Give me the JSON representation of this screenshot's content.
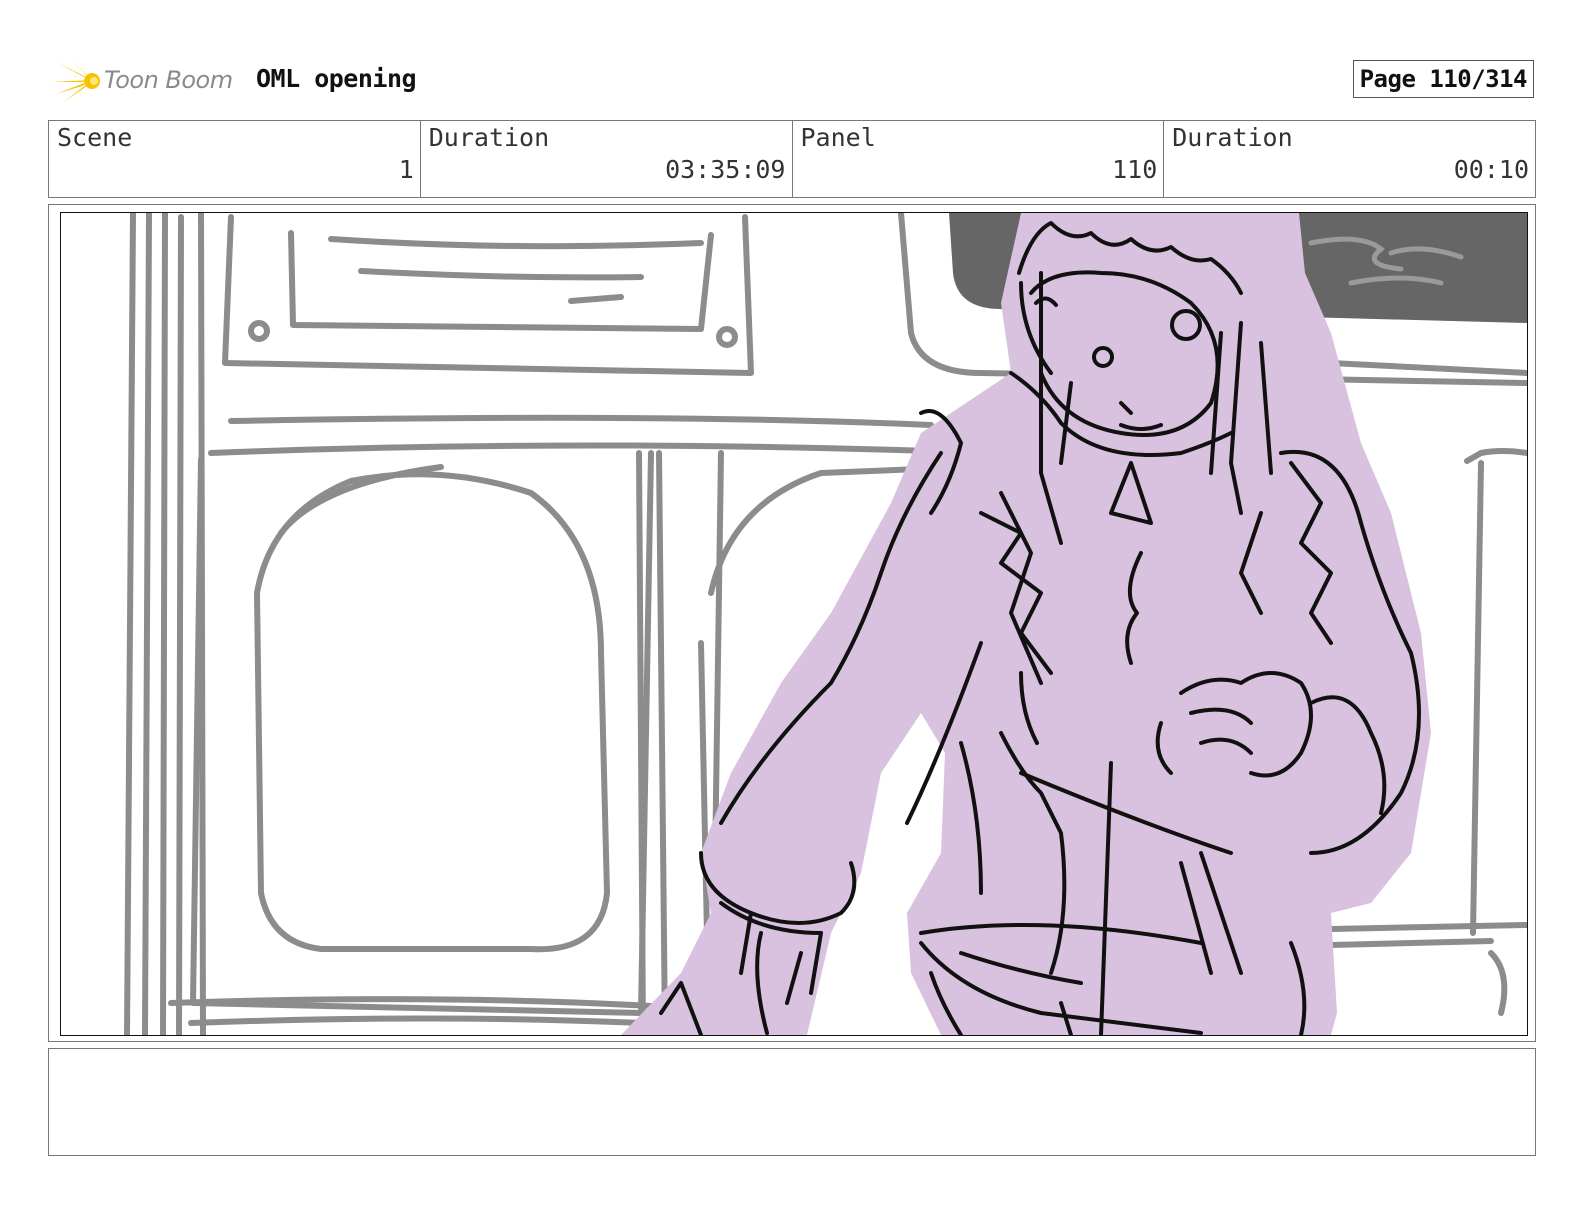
{
  "header": {
    "logo_text": "Toon Boom",
    "project_title": "OML opening",
    "page_label": "Page 110/314"
  },
  "info": [
    {
      "label": "Scene",
      "value": "1"
    },
    {
      "label": "Duration",
      "value": "03:35:09"
    },
    {
      "label": "Panel",
      "value": "110"
    },
    {
      "label": "Duration",
      "value": "00:10"
    }
  ],
  "panel": {
    "fill_color": "#d8c2df",
    "background_line_color": "#8c8c8c",
    "ink_color": "#111111",
    "sign_color": "#666666"
  },
  "notes": {
    "text": ""
  }
}
